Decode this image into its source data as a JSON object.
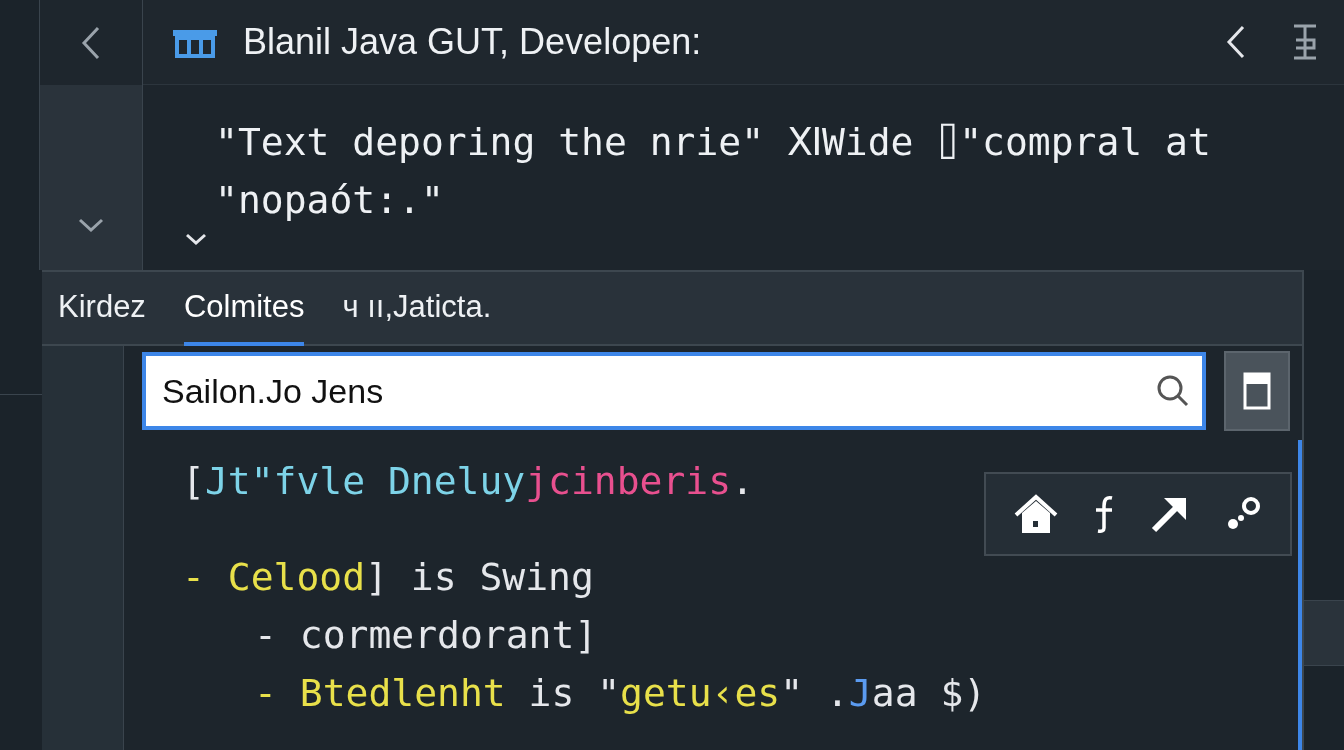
{
  "header": {
    "title": "Blanil Java GUT, Developen:"
  },
  "description": [
    "\"Text deporing the nrie\" ⅪWide ⌷\"compral at",
    "\"nopaót:.\""
  ],
  "tabs": [
    {
      "label": "Kirdez",
      "selected": false
    },
    {
      "label": "Colmites",
      "selected": true
    },
    {
      "label": "ч ıı,Jaticta.",
      "selected": false
    }
  ],
  "search": {
    "value": "Sailon.Jo Jens"
  },
  "code_lines": [
    {
      "tokens": [
        {
          "text": "[",
          "color": "#e5e7eb"
        },
        {
          "text": "Jt\"fvle Dneluy",
          "color": "#7dd3e8"
        },
        {
          "text": "jcinberis",
          "color": "#e8508f"
        },
        {
          "text": ".",
          "color": "#e5e7eb"
        }
      ]
    },
    {
      "tokens": [
        {
          "text": "- ",
          "color": "#e8e04a"
        },
        {
          "text": "Celood",
          "color": "#e8e04a"
        },
        {
          "text": "] is Swing",
          "color": "#e5e7eb"
        }
      ],
      "children": [
        {
          "tokens": [
            {
              "text": "- cormerdorant]",
              "color": "#e5e7eb"
            }
          ]
        },
        {
          "tokens": [
            {
              "text": "- ",
              "color": "#e8e04a"
            },
            {
              "text": "Btedlenht",
              "color": "#e8e04a"
            },
            {
              "text": " is \"",
              "color": "#e5e7eb"
            },
            {
              "text": "getu‹es",
              "color": "#e8e04a"
            },
            {
              "text": "\" .",
              "color": "#e5e7eb"
            },
            {
              "text": "J",
              "color": "#5b9bf0"
            },
            {
              "text": "aa $)",
              "color": "#e5e7eb"
            }
          ]
        }
      ]
    }
  ]
}
